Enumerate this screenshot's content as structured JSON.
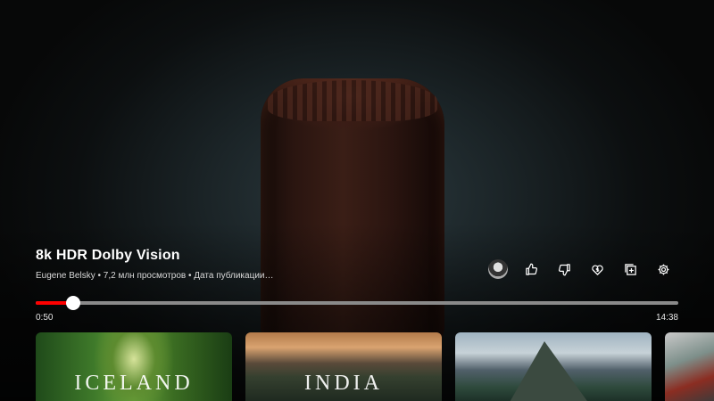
{
  "video": {
    "title": "8k HDR Dolby Vision",
    "meta": "Eugene Belsky • 7,2 млн просмотров • Дата публикации…"
  },
  "actions": [
    {
      "name": "channel-avatar"
    },
    {
      "name": "like-icon"
    },
    {
      "name": "dislike-icon"
    },
    {
      "name": "thanks-icon"
    },
    {
      "name": "save-to-playlist-icon"
    },
    {
      "name": "settings-gear-icon"
    }
  ],
  "player": {
    "current_time": "0:50",
    "total_time": "14:38",
    "progress_fraction": 0.058,
    "colors": {
      "progress": "#ff0000",
      "track": "#8a8a8a",
      "knob": "#ffffff"
    }
  },
  "shelf": {
    "cards": [
      {
        "label": "ICELAND"
      },
      {
        "label": "INDIA"
      },
      {
        "label": ""
      },
      {
        "label": ""
      }
    ]
  }
}
